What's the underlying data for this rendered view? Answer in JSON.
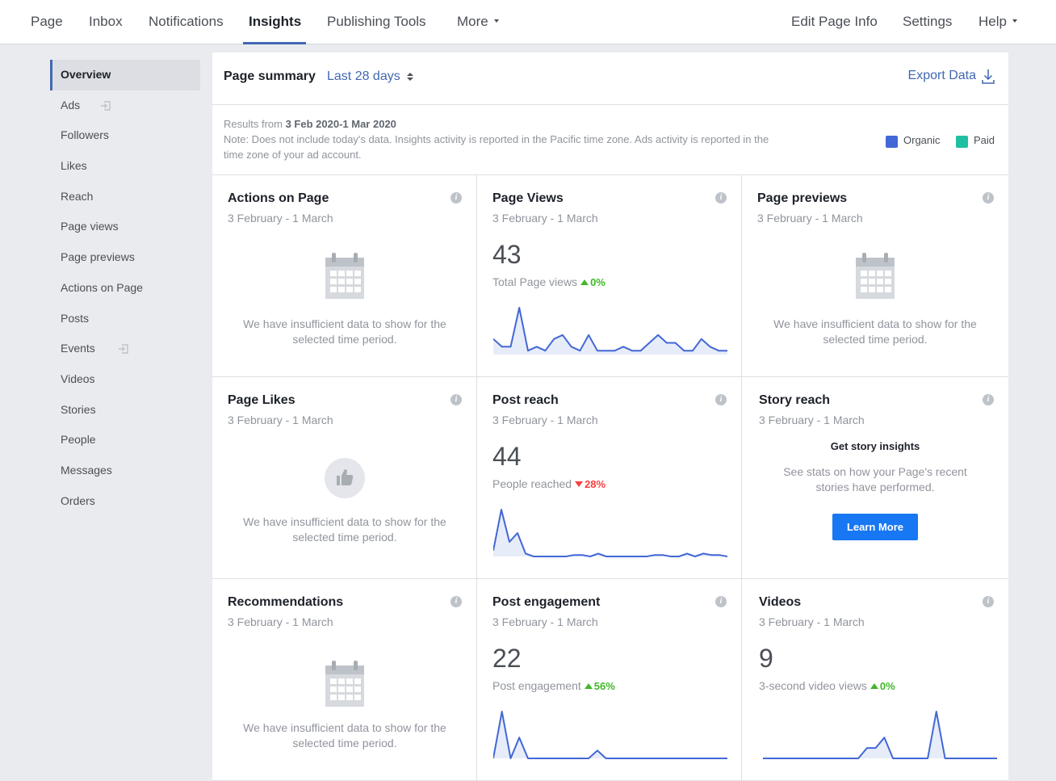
{
  "topnav": {
    "left": [
      "Page",
      "Inbox",
      "Notifications",
      "Insights",
      "Publishing Tools",
      "More"
    ],
    "right": [
      "Edit Page Info",
      "Settings",
      "Help"
    ],
    "active": "Insights"
  },
  "sidebar": {
    "items": [
      "Overview",
      "Ads",
      "Followers",
      "Likes",
      "Reach",
      "Page views",
      "Page previews",
      "Actions on Page",
      "Posts",
      "Events",
      "Videos",
      "Stories",
      "People",
      "Messages",
      "Orders"
    ],
    "active": "Overview"
  },
  "summary": {
    "title": "Page summary",
    "range": "Last 28 days",
    "export": "Export Data",
    "results_prefix": "Results from",
    "results_range": "3 Feb 2020-1 Mar 2020",
    "note_line1": "Note: Does not include today's data. Insights activity is reported in the Pacific time zone. Ads activity is reported in the",
    "note_line2": "time zone of your ad account.",
    "legend": [
      {
        "label": "Organic",
        "color": "#4267d6"
      },
      {
        "label": "Paid",
        "color": "#1fbfa1"
      }
    ]
  },
  "empty_text_1": "We have insufficient data to show for the",
  "empty_text_2": "selected time period.",
  "cards": {
    "actions": {
      "title": "Actions on Page",
      "date": "3 February - 1 March"
    },
    "page_views": {
      "title": "Page Views",
      "date": "3 February - 1 March",
      "value": "43",
      "label": "Total Page views",
      "change": "0%",
      "trend": "up",
      "series": [
        4,
        2,
        2,
        12,
        1,
        2,
        1,
        4,
        5,
        2,
        1,
        5,
        1,
        1,
        1,
        2,
        1,
        1,
        3,
        5,
        3,
        3,
        1,
        1,
        4,
        2,
        1,
        1
      ]
    },
    "page_previews": {
      "title": "Page previews",
      "date": "3 February - 1 March"
    },
    "page_likes": {
      "title": "Page Likes",
      "date": "3 February - 1 March"
    },
    "post_reach": {
      "title": "Post reach",
      "date": "3 February - 1 March",
      "value": "44",
      "label": "People reached",
      "change": "28%",
      "trend": "down",
      "series": [
        2,
        16,
        5,
        8,
        1,
        0,
        0,
        0,
        0,
        0,
        0.5,
        0.5,
        0,
        1,
        0,
        0,
        0,
        0,
        0,
        0,
        0.5,
        0.5,
        0,
        0,
        1,
        0,
        1,
        0.5,
        0.5,
        0
      ]
    },
    "story_reach": {
      "title": "Story reach",
      "date": "3 February - 1 March",
      "heading": "Get story insights",
      "text1": "See stats on how your Page's recent",
      "text2": "stories have performed.",
      "button": "Learn More"
    },
    "recommendations": {
      "title": "Recommendations",
      "date": "3 February - 1 March"
    },
    "post_engagement": {
      "title": "Post engagement",
      "date": "3 February - 1 March",
      "value": "22",
      "label": "Post engagement",
      "change": "56%",
      "trend": "up",
      "series": [
        0,
        9,
        0,
        4,
        0,
        0,
        0,
        0,
        0,
        0,
        0,
        0,
        1.5,
        0,
        0,
        0,
        0,
        0,
        0,
        0,
        0,
        0,
        0,
        0,
        0,
        0,
        0,
        0
      ]
    },
    "videos": {
      "title": "Videos",
      "date": "3 February - 1 March",
      "value": "9",
      "label": "3-second video views",
      "change": "0%",
      "trend": "up",
      "series": [
        0,
        0,
        0,
        0,
        0,
        0,
        0,
        0,
        0,
        0,
        0,
        0,
        2,
        2,
        4,
        0,
        0,
        0,
        0,
        0,
        9,
        0,
        0,
        0,
        0,
        0,
        0,
        0
      ]
    }
  },
  "chart_data": [
    {
      "type": "line",
      "title": "Page Views",
      "x": "days 3 Feb - 1 Mar 2020",
      "values": [
        4,
        2,
        2,
        12,
        1,
        2,
        1,
        4,
        5,
        2,
        1,
        5,
        1,
        1,
        1,
        2,
        1,
        1,
        3,
        5,
        3,
        3,
        1,
        1,
        4,
        2,
        1,
        1
      ]
    },
    {
      "type": "line",
      "title": "Post reach",
      "x": "days 3 Feb - 1 Mar 2020",
      "values": [
        2,
        16,
        5,
        8,
        1,
        0,
        0,
        0,
        0,
        0,
        0.5,
        0.5,
        0,
        1,
        0,
        0,
        0,
        0,
        0,
        0,
        0.5,
        0.5,
        0,
        0,
        1,
        0,
        1,
        0.5,
        0.5,
        0
      ]
    },
    {
      "type": "line",
      "title": "Post engagement",
      "x": "days 3 Feb - 1 Mar 2020",
      "values": [
        0,
        9,
        0,
        4,
        0,
        0,
        0,
        0,
        0,
        0,
        0,
        0,
        1.5,
        0,
        0,
        0,
        0,
        0,
        0,
        0,
        0,
        0,
        0,
        0,
        0,
        0,
        0,
        0
      ]
    },
    {
      "type": "line",
      "title": "Videos",
      "x": "days 3 Feb - 1 Mar 2020",
      "values": [
        0,
        0,
        0,
        0,
        0,
        0,
        0,
        0,
        0,
        0,
        0,
        0,
        2,
        2,
        4,
        0,
        0,
        0,
        0,
        0,
        9,
        0,
        0,
        0,
        0,
        0,
        0,
        0
      ]
    }
  ]
}
